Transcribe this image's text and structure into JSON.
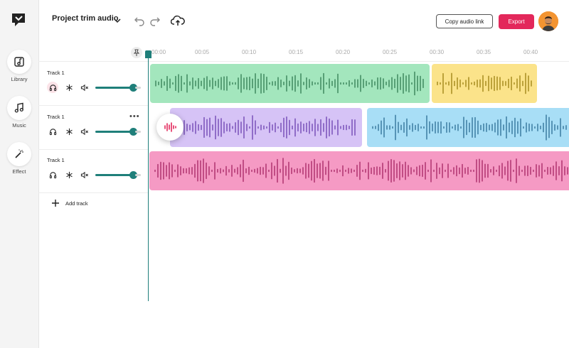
{
  "app": {
    "title": "Project trim audio"
  },
  "sidebar": {
    "items": [
      {
        "label": "Library",
        "icon": "library-icon"
      },
      {
        "label": "Music",
        "icon": "music-note-icon"
      },
      {
        "label": "Effect",
        "icon": "magic-wand-icon"
      }
    ]
  },
  "header": {
    "copy_link_label": "Copy audio link",
    "export_label": "Export"
  },
  "ruler": {
    "ticks": [
      "00:00",
      "00:05",
      "00:10",
      "00:15",
      "00:20",
      "00:25",
      "00:30",
      "00:35",
      "00:40"
    ]
  },
  "tracks": [
    {
      "name": "Track 1"
    },
    {
      "name": "Track 1",
      "more": "•••"
    },
    {
      "name": "Track 1"
    }
  ],
  "add_track_label": "Add track",
  "colors": {
    "accent": "#1f7f7a",
    "export": "#e3285b",
    "clip_green": "#a3e6bd",
    "clip_yellow": "#fbe38a",
    "clip_purple": "#d6c3f6",
    "clip_blue": "#a8def6",
    "clip_pink": "#f59ac4"
  }
}
